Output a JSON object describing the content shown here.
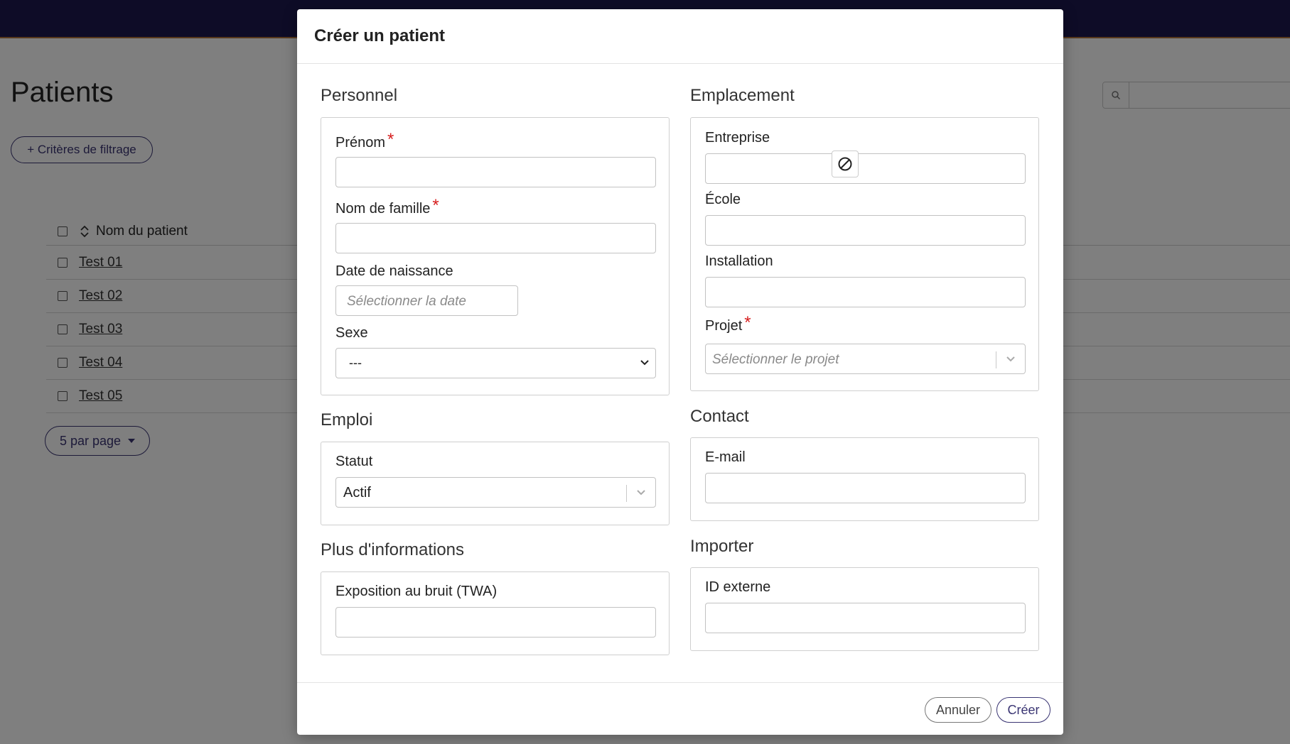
{
  "background": {
    "page_title": "Patients",
    "filter_button": "+ Critères de filtrage",
    "table": {
      "column_header": "Nom du patient",
      "rows": [
        "Test 01",
        "Test 02",
        "Test 03",
        "Test 04",
        "Test 05"
      ]
    },
    "per_page": "5 par page"
  },
  "modal": {
    "title": "Créer un patient",
    "sections": {
      "personnel": {
        "title": "Personnel",
        "prenom_label": "Prénom",
        "nom_label": "Nom de famille",
        "dob_label": "Date de naissance",
        "dob_placeholder": "Sélectionner la date",
        "sexe_label": "Sexe",
        "sexe_value": "---"
      },
      "emplacement": {
        "title": "Emplacement",
        "entreprise_label": "Entreprise",
        "ecole_label": "École",
        "installation_label": "Installation",
        "projet_label": "Projet",
        "projet_placeholder": "Sélectionner le projet"
      },
      "emploi": {
        "title": "Emploi",
        "statut_label": "Statut",
        "statut_value": "Actif"
      },
      "contact": {
        "title": "Contact",
        "email_label": "E-mail"
      },
      "plus": {
        "title": "Plus d'informations",
        "bruit_label": "Exposition au bruit (TWA)"
      },
      "importer": {
        "title": "Importer",
        "id_label": "ID externe"
      }
    },
    "required_mark": "*",
    "footer": {
      "cancel": "Annuler",
      "create": "Créer"
    }
  },
  "colors": {
    "topbar": "#1c184f",
    "accent": "#3a3573",
    "required": "#d61f1f"
  }
}
